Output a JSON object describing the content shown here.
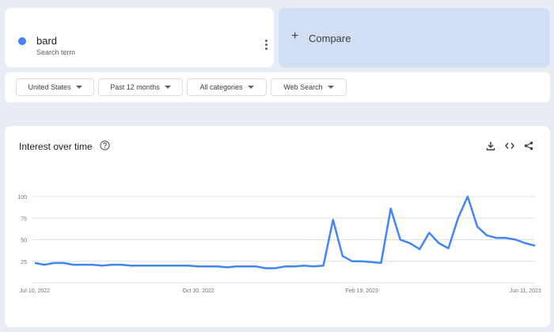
{
  "search_term": {
    "name": "bard",
    "subtitle": "Search term",
    "dot_color": "#4285f4",
    "menu_icon": "more-vert-icon"
  },
  "compare": {
    "label": "Compare",
    "icon": "plus-icon"
  },
  "filters": [
    {
      "label": "United States"
    },
    {
      "label": "Past 12 months"
    },
    {
      "label": "All categories"
    },
    {
      "label": "Web Search"
    }
  ],
  "interest_panel": {
    "title": "Interest over time",
    "icons": [
      "help-icon",
      "download-icon",
      "embed-code-icon",
      "share-icon"
    ]
  },
  "chart_data": {
    "type": "line",
    "title": "",
    "xlabel": "",
    "ylabel": "",
    "x_tick_labels": [
      "Jul 10, 2022",
      "Oct 30, 2022",
      "Feb 19, 2023",
      "Jun 11, 2023"
    ],
    "y_ticks": [
      25,
      50,
      75,
      100
    ],
    "ylim": [
      0,
      100
    ],
    "grid": true,
    "line_color": "#4285f4",
    "series": [
      {
        "values": [
          23,
          21,
          23,
          23,
          21,
          21,
          21,
          20,
          21,
          21,
          20,
          20,
          20,
          20,
          20,
          20,
          20,
          19,
          19,
          19,
          18,
          19,
          19,
          19,
          17,
          17,
          19,
          19,
          20,
          19,
          20,
          73,
          31,
          25,
          25,
          24,
          23,
          86,
          50,
          46,
          39,
          58,
          46,
          40,
          75,
          100,
          65,
          55,
          52,
          52,
          50,
          46,
          43
        ]
      }
    ]
  }
}
